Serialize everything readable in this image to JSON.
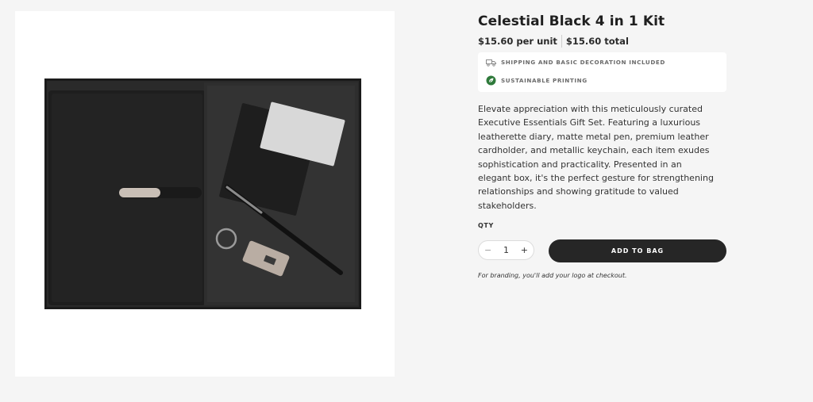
{
  "product": {
    "title": "Celestial Black 4 in 1 Kit",
    "unit_price": "$15.60 per unit",
    "total_price": "$15.60 total",
    "description": "Elevate appreciation with this meticulously curated Executive Essentials Gift Set. Featuring a luxurious leatherette diary, matte metal pen, premium leather cardholder, and metallic keychain, each item exudes sophistication and practicality. Presented in an elegant box, it's the perfect gesture for strengthening relationships and showing gratitude to valued stakeholders."
  },
  "perks": [
    {
      "icon": "truck-icon",
      "label": "SHIPPING AND BASIC DECORATION INCLUDED"
    },
    {
      "icon": "leaf-icon",
      "label": "SUSTAINABLE PRINTING"
    }
  ],
  "purchase": {
    "qty_label": "QTY",
    "minus": "−",
    "plus": "+",
    "qty_value": "1",
    "add_label": "ADD TO BAG",
    "note": "For branding, you'll add your logo at checkout."
  },
  "colors": {
    "button": "#262626",
    "leaf": "#2f7a3b",
    "background": "#f5f5f5"
  }
}
